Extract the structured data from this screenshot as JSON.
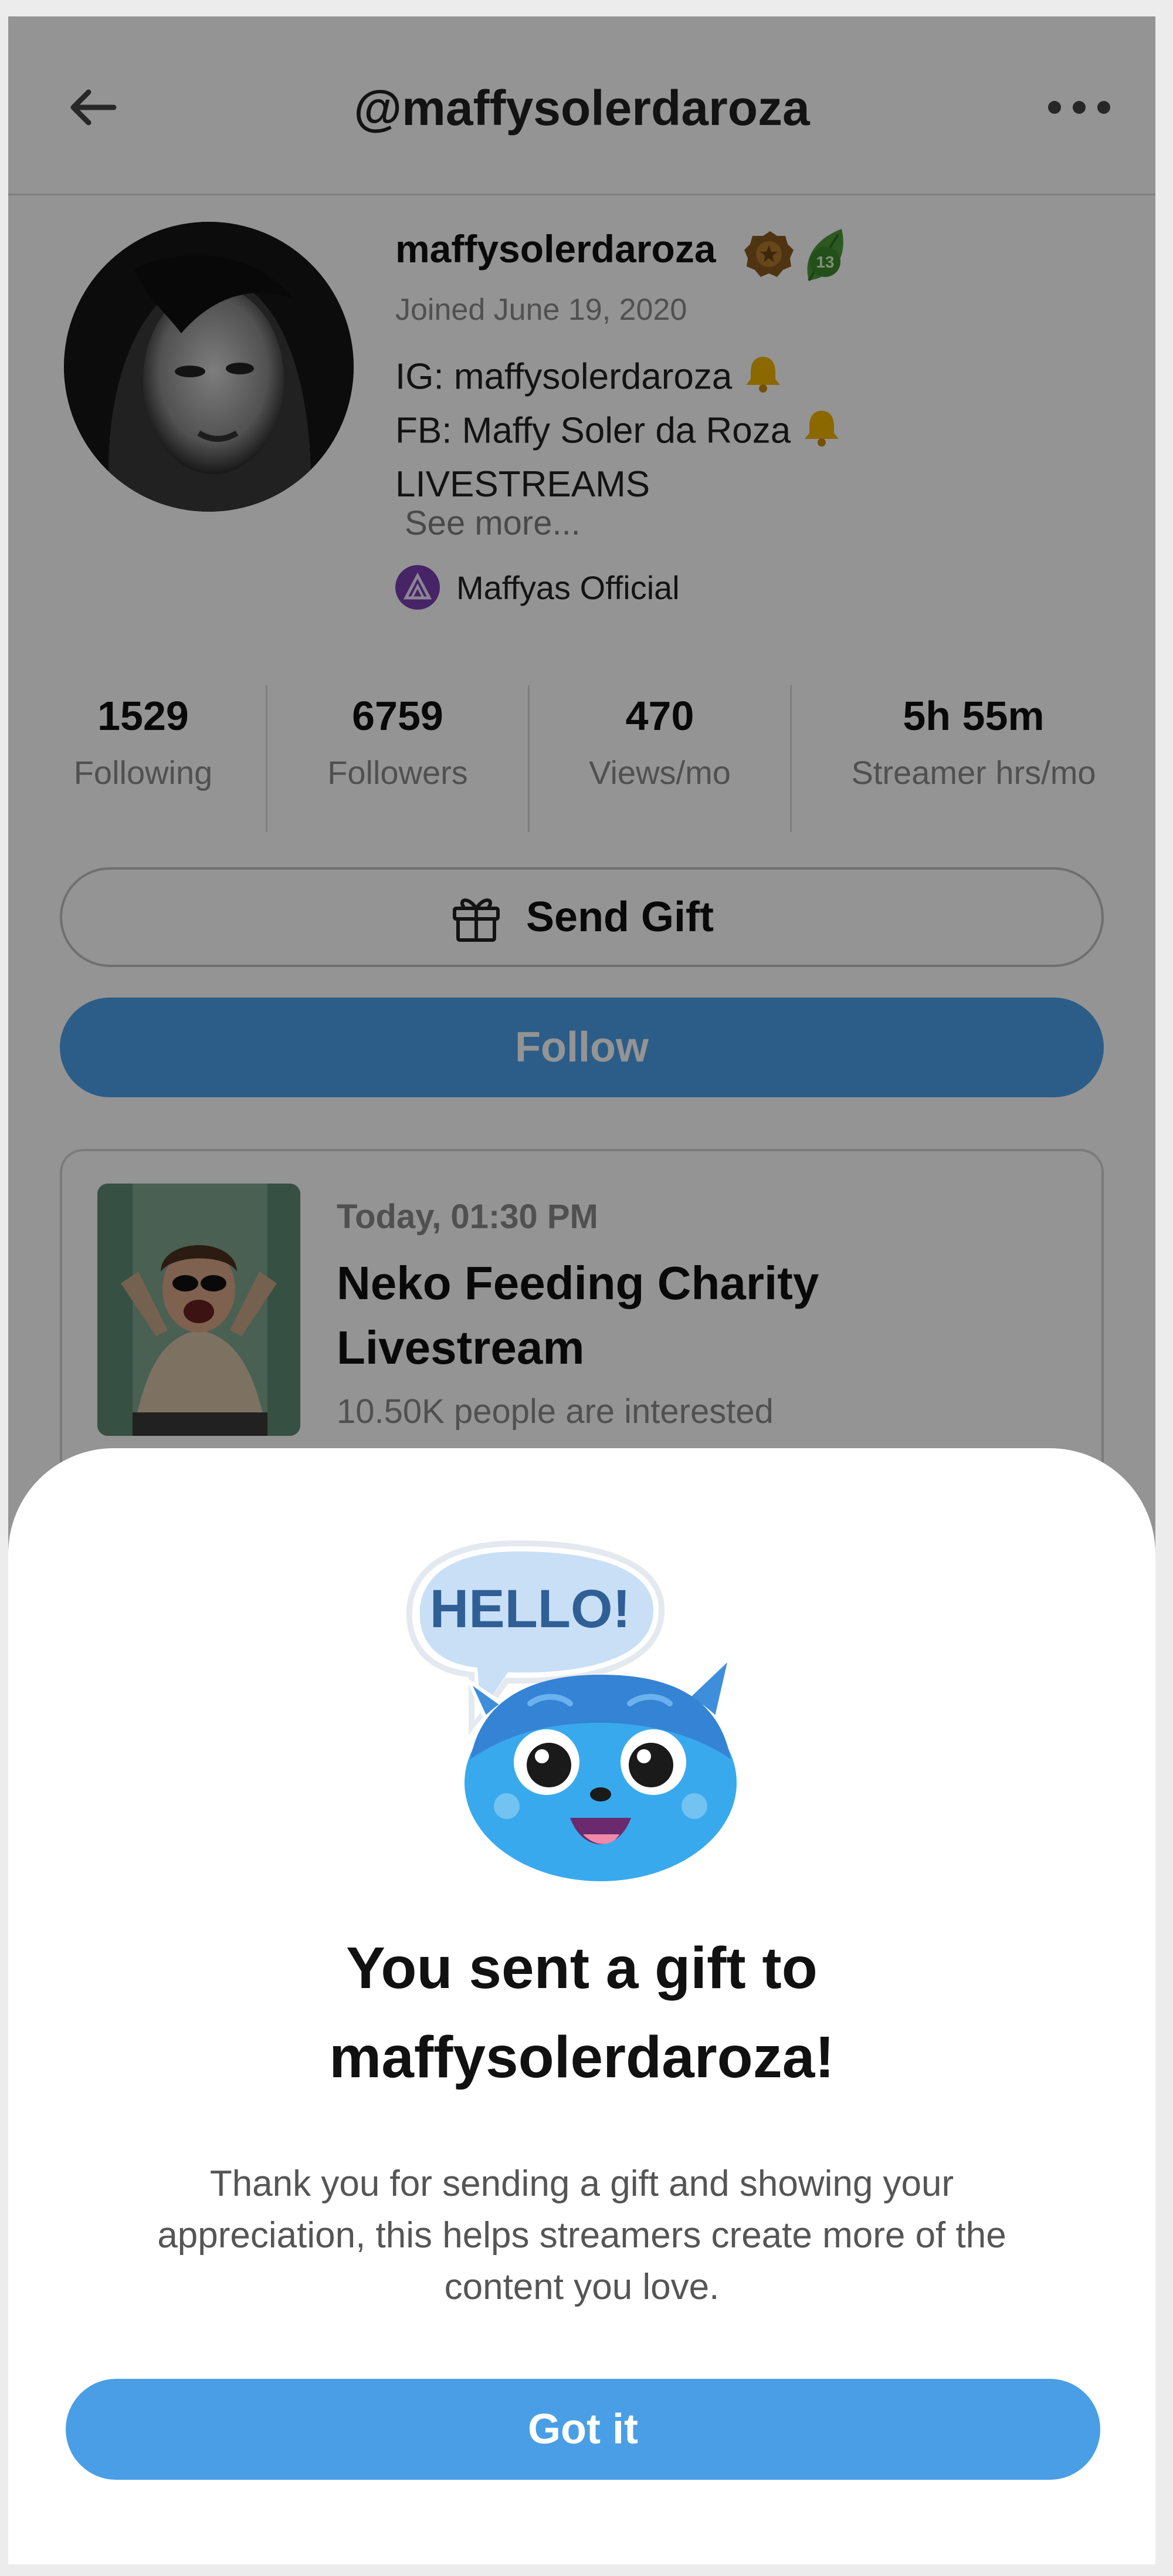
{
  "header": {
    "title": "@maffysolerdaroza"
  },
  "profile": {
    "display_name": "maffysolerdaroza",
    "level_badge": "13",
    "joined": "Joined June 19, 2020",
    "bio_lines": [
      "IG: maffysolerdaroza",
      "FB: Maffy Soler da Roza",
      "LIVESTREAMS"
    ],
    "see_more": "See more...",
    "organization": "Maffyas Official"
  },
  "stats": [
    {
      "value": "1529",
      "label": "Following"
    },
    {
      "value": "6759",
      "label": "Followers"
    },
    {
      "value": "470",
      "label": "Views/mo"
    },
    {
      "value": "5h 55m",
      "label": "Streamer hrs/mo"
    }
  ],
  "buttons": {
    "send_gift": "Send Gift",
    "follow": "Follow"
  },
  "event": {
    "date": "Today, 01:30 PM",
    "title_line1": "Neko Feeding Charity",
    "title_line2": "Livestream",
    "interested": "10.50K people are interested"
  },
  "modal": {
    "mascot_text": "HELLO!",
    "title_line1": "You sent a gift to",
    "title_line2": "maffysolerdaroza!",
    "body_line1": "Thank you for sending a gift and showing your",
    "body_line2": "appreciation, this helps streamers create more of the",
    "body_line3": "content you love.",
    "confirm": "Got it"
  },
  "colors": {
    "primary": "#4a9ee6",
    "follow": "#4aa0ea",
    "overlay": "rgba(0,0,0,0.42)"
  },
  "icons": [
    "back-arrow-icon",
    "more-dots-icon",
    "rank-badge-icon",
    "level-leaf-icon",
    "bell-icon",
    "organization-icon",
    "gift-icon",
    "mascot-icon"
  ]
}
